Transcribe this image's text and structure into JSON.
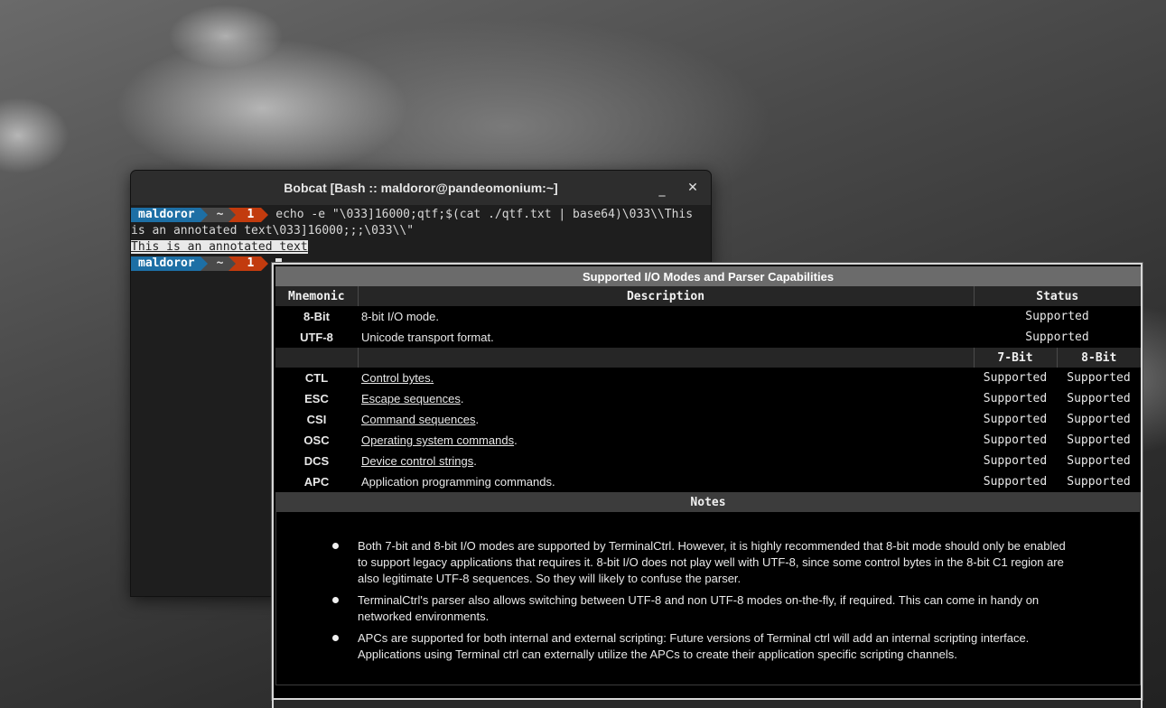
{
  "window": {
    "title": "Bobcat [Bash :: maldoror@pandeomonium:~]",
    "minimize_label": "_",
    "close_label": "✕"
  },
  "prompt": {
    "user": "maldoror",
    "dir": "~",
    "num": "1"
  },
  "console": {
    "command": "echo -e \"\\033]16000;qtf;$(cat ./qtf.txt | base64)\\033\\\\This",
    "command_wrap": "is an annotated text\\033]16000;;;\\033\\\\\"",
    "output": "This is an annotated text"
  },
  "popup": {
    "title": "Supported I/O Modes and Parser Capabilities",
    "headers": {
      "mnemonic": "Mnemonic",
      "description": "Description",
      "status": "Status"
    },
    "modes": [
      {
        "mnemonic": "8-Bit",
        "description": "8-bit I/O mode.",
        "status": "Supported"
      },
      {
        "mnemonic": "UTF-8",
        "description": "Unicode transport format.",
        "status": "Supported"
      }
    ],
    "subheaders": {
      "bit7": "7-Bit",
      "bit8": "8-Bit"
    },
    "parser": [
      {
        "mnemonic": "CTL",
        "link": "Control bytes.",
        "suffix": "",
        "s7": "Supported",
        "s8": "Supported"
      },
      {
        "mnemonic": "ESC",
        "link": "Escape sequences",
        "suffix": ".",
        "s7": "Supported",
        "s8": "Supported"
      },
      {
        "mnemonic": "CSI",
        "link": "Command sequences",
        "suffix": ".",
        "s7": "Supported",
        "s8": "Supported"
      },
      {
        "mnemonic": "OSC",
        "link": "Operating system commands",
        "suffix": ".",
        "s7": "Supported",
        "s8": "Supported"
      },
      {
        "mnemonic": "DCS",
        "link": "Device control strings",
        "suffix": ".",
        "s7": "Supported",
        "s8": "Supported"
      },
      {
        "mnemonic": "APC",
        "link": "",
        "suffix": "Application programming commands.",
        "s7": "Supported",
        "s8": "Supported"
      }
    ],
    "notes_title": "Notes",
    "notes": [
      "Both 7-bit and 8-bit I/O modes are supported by TerminalCtrl. However, it is highly recommended that 8-bit mode should only be enabled to support legacy applications that requires it. 8-bit I/O does not play well with UTF-8, since some control bytes in the 8-bit C1 region are also legitimate UTF-8 sequences. So they will likely to confuse the parser.",
      "TerminalCtrl's parser also allows switching between UTF-8 and non UTF-8 modes on-the-fly, if required. This can come in handy on networked environments.",
      "APCs are supported for both internal and external scripting: Future versions of Terminal ctrl will add an internal scripting interface. Applications using Terminal ctrl can externally utilize the APCs to create their application specific scripting channels."
    ]
  }
}
